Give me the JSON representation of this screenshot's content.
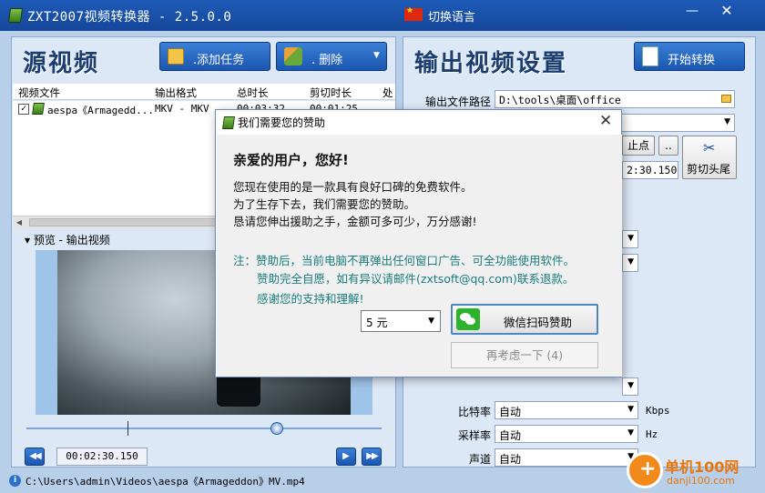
{
  "window": {
    "title": "ZXT2007视频转换器 - 2.5.0.0",
    "language_label": "切换语言",
    "minimize": "—",
    "close": "✕"
  },
  "left": {
    "title": "源视频",
    "add_task": ".添加任务",
    "delete": ".  删除",
    "columns": [
      "视频文件",
      "输出格式",
      "总时长",
      "剪切时长",
      "处"
    ],
    "rows": [
      {
        "file": "aespa《Armagedd...",
        "format": "MKV - MKV ...",
        "total": "00:03:32...",
        "cut": "00:01:25..."
      }
    ],
    "preview_label": "▾ 预览 - 输出视频",
    "time": "00:02:30.150",
    "rewind": "◀◀",
    "play": "▶",
    "forward": "▶▶"
  },
  "right": {
    "title": "输出视频设置",
    "start_button": "开始转换",
    "output_path_label": "输出文件路径",
    "output_path": "D:\\tools\\桌面\\office",
    "end_point_button": "止点",
    "dots_button": "..",
    "end_time": "2:30.150",
    "cut_head_tail": "剪切头尾",
    "bitrate_label": "比特率",
    "bitrate_value": "自动",
    "bitrate_unit": "Kbps",
    "samplerate_label": "采样率",
    "samplerate_value": "自动",
    "samplerate_unit": "Hz",
    "channel_label": "声道",
    "channel_value": "自动"
  },
  "status": {
    "path": "C:\\Users\\admin\\Videos\\aespa《Armageddon》MV.mp4"
  },
  "watermark": {
    "name": "单机100网",
    "url": "danji100.com"
  },
  "dialog": {
    "title": "我们需要您的赞助",
    "greeting": "亲爱的用户，您好!",
    "line1": "您现在使用的是一款具有良好口碑的免费软件。",
    "line2": "为了生存下去，我们需要您的赞助。",
    "line3": "恳请您伸出援助之手，金额可多可少，万分感谢!",
    "note1": "注：赞助后，当前电脑不再弹出任何窗口广告、可全功能使用软件。",
    "note2": "赞助完全自愿，如有异议请邮件(zxtsoft@qq.com)联系退款。",
    "note3": "感谢您的支持和理解!",
    "amount": "5 元",
    "wechat_button": "微信扫码赞助",
    "later_button": "再考虑一下 (4)"
  },
  "colors": {
    "titlebar": "#1e5bb8",
    "panel": "#dde8f6",
    "accent": "#2a6fc9",
    "note": "#1a7c7c"
  }
}
